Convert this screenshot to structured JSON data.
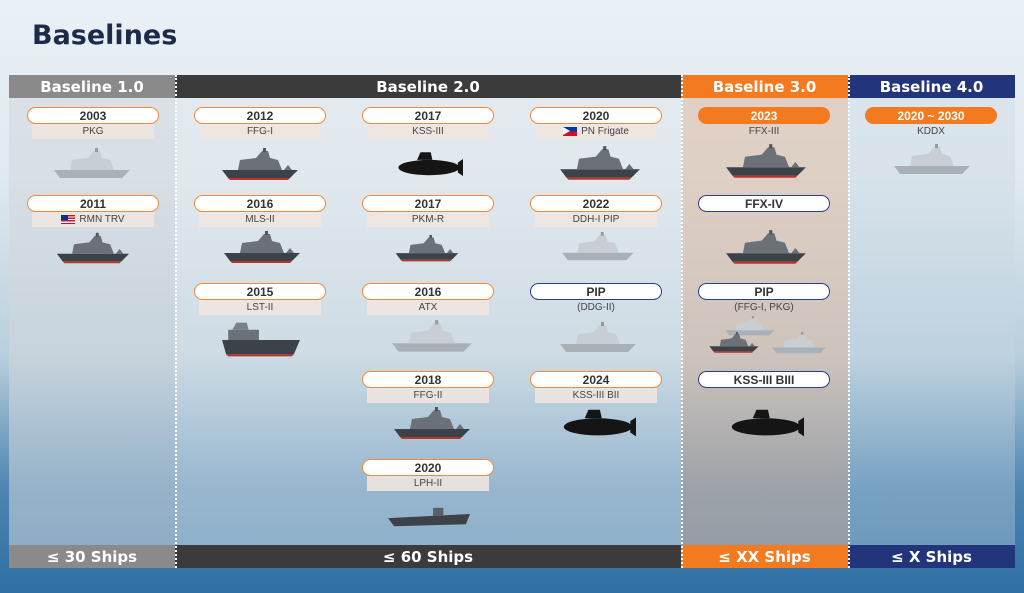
{
  "page": {
    "title": "Baselines"
  },
  "columns": [
    {
      "id": "b1",
      "header": "Baseline 1.0",
      "footer": "≤ 30 Ships"
    },
    {
      "id": "b2",
      "header": "Baseline 2.0",
      "footer": "≤ 60 Ships"
    },
    {
      "id": "b3",
      "header": "Baseline 3.0",
      "footer": "≤ XX Ships"
    },
    {
      "id": "b4",
      "header": "Baseline 4.0",
      "footer": "≤ X Ships"
    }
  ],
  "items": {
    "pkg": {
      "year": "2003",
      "name": "PKG"
    },
    "rmn": {
      "year": "2011",
      "name": "RMN TRV"
    },
    "ffg1": {
      "year": "2012",
      "name": "FFG-I"
    },
    "mls2": {
      "year": "2016",
      "name": "MLS-II"
    },
    "lst2": {
      "year": "2015",
      "name": "LST-II"
    },
    "kss3": {
      "year": "2017",
      "name": "KSS-III"
    },
    "pkmr": {
      "year": "2017",
      "name": "PKM-R"
    },
    "atx": {
      "year": "2016",
      "name": "ATX"
    },
    "ffg2": {
      "year": "2018",
      "name": "FFG-II"
    },
    "lph2": {
      "year": "2020",
      "name": "LPH-II"
    },
    "pn": {
      "year": "2020",
      "name": "PN Frigate"
    },
    "ddh": {
      "year": "2022",
      "name": "DDH-I PIP"
    },
    "pipddg": {
      "year": "PIP",
      "name": "(DDG-II)"
    },
    "kss3b2": {
      "year": "2024",
      "name": "KSS-III BII"
    },
    "ffx3": {
      "year": "2023",
      "name": "FFX-III"
    },
    "ffx4": {
      "year": "FFX-IV"
    },
    "pipffg": {
      "year": "PIP",
      "name": "(FFG-I, PKG)"
    },
    "kss3b3": {
      "year": "KSS-III BIII"
    },
    "kddx": {
      "year": "2020 ~ 2030",
      "name": "KDDX"
    }
  },
  "colors": {
    "baseline1": "#8a8a8a",
    "baseline2": "#3b3b3b",
    "baseline3": "#f37a1f",
    "baseline4": "#23357a",
    "year_border_orange": "#f08a3a",
    "year_border_blue": "#2a3f8a"
  },
  "icons": [
    "frigate-ship-icon",
    "submarine-icon",
    "landing-ship-icon",
    "malaysia-flag-icon",
    "philippines-flag-icon"
  ]
}
